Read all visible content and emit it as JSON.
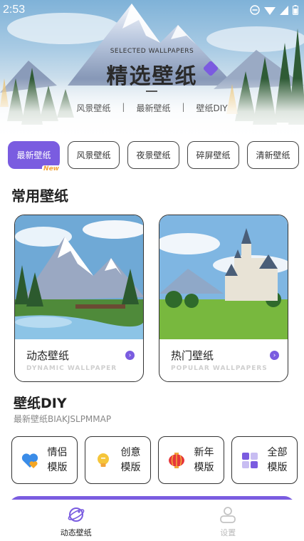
{
  "status_bar": {
    "time": "2:53"
  },
  "hero": {
    "subtitle": "SELECTED WALLPAPERS",
    "title": "精选壁纸",
    "links": [
      "风景壁纸",
      "最新壁纸",
      "壁纸DIY"
    ],
    "separator": "|"
  },
  "tabs": [
    {
      "label": "最新壁纸",
      "active": true,
      "badge": "New"
    },
    {
      "label": "风景壁纸"
    },
    {
      "label": "夜景壁纸"
    },
    {
      "label": "碎屏壁纸"
    },
    {
      "label": "清新壁纸"
    }
  ],
  "common": {
    "title": "常用壁纸",
    "cards": [
      {
        "name": "动态壁纸",
        "en": "DYNAMIC WALLPAPER",
        "arrow": "›"
      },
      {
        "name": "热门壁纸",
        "en": "POPULAR WALLPAPERS",
        "arrow": "›"
      }
    ]
  },
  "diy": {
    "title": "壁纸DIY",
    "subtitle": "最新壁纸BIAKJSLPMMAP",
    "items": [
      {
        "label": "情侣模版",
        "icon": "heart-icon"
      },
      {
        "label": "创意模版",
        "icon": "lightbulb-icon"
      },
      {
        "label": "新年模版",
        "icon": "lantern-icon"
      },
      {
        "label": "全部模版",
        "icon": "grid-icon"
      }
    ]
  },
  "bottom_nav": [
    {
      "label": "动态壁纸",
      "icon": "planet-icon",
      "active": true
    },
    {
      "label": "设置",
      "icon": "person-icon",
      "active": false
    }
  ],
  "colors": {
    "accent": "#7a5ce0",
    "badge": "#f2a53a"
  }
}
